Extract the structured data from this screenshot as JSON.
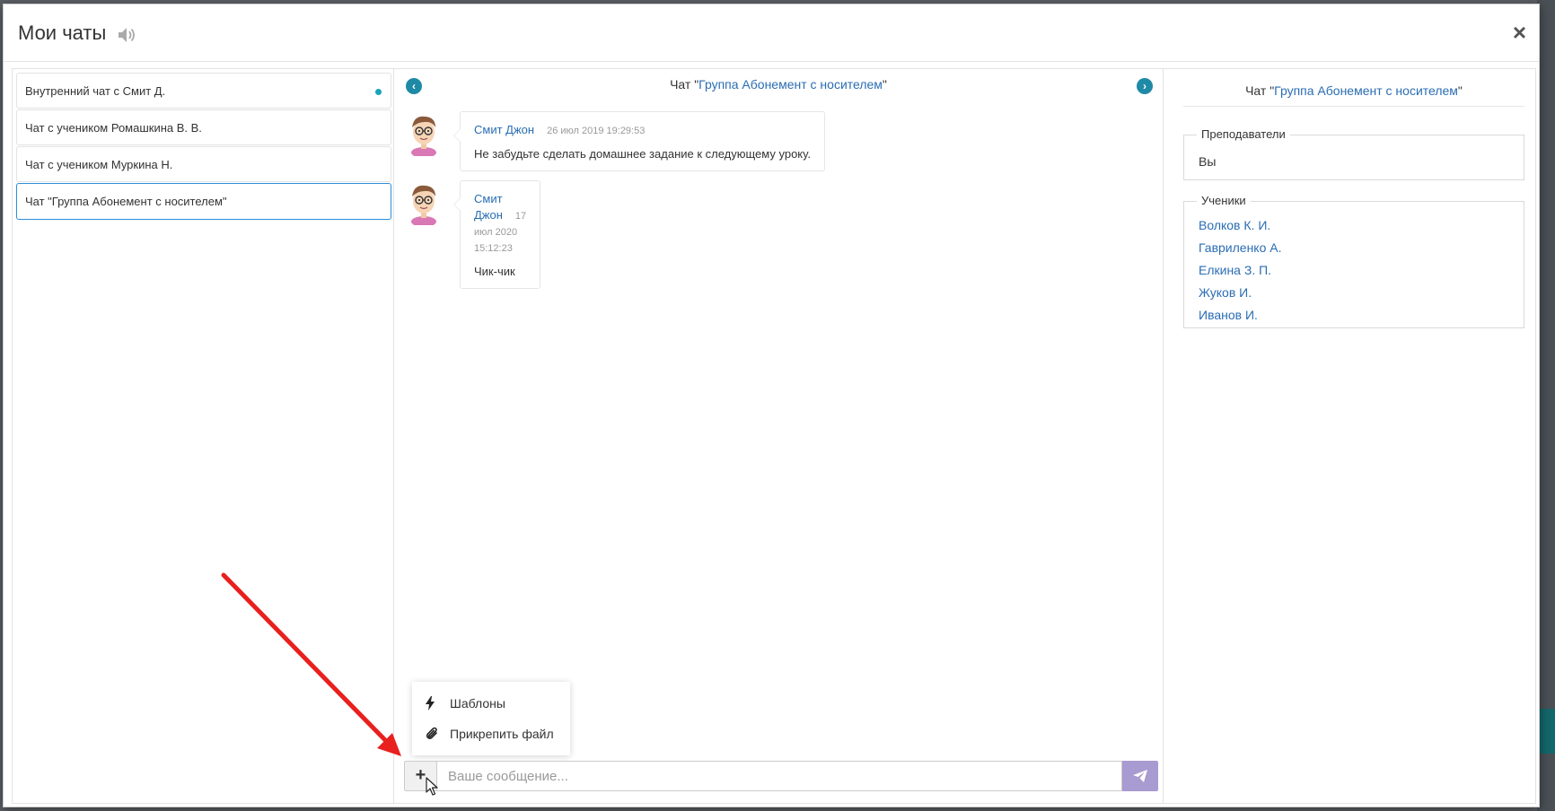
{
  "colors": {
    "link": "#2a6db3",
    "active_border": "#2d8ed8",
    "unread_dot": "#1aa3b8",
    "nav_arrow": "#1f8aa6",
    "send_button": "#a79bd1",
    "annotation_arrow": "#e8201e"
  },
  "modal": {
    "title": "Мои чаты",
    "close_label": "×"
  },
  "chat_list": [
    {
      "label": "Внутренний чат с Смит Д.",
      "unread": true
    },
    {
      "label": "Чат с учеником Ромашкина В. В.",
      "unread": false
    },
    {
      "label": "Чат с учеником Муркина Н.",
      "unread": false
    },
    {
      "label": "Чат \"Группа Абонемент с носителем\"",
      "unread": false,
      "active": true
    }
  ],
  "chat": {
    "prefix": "Чат \"",
    "name": "Группа Абонемент с носителем",
    "suffix": "\"",
    "messages": [
      {
        "author": "Смит Джон",
        "time": "26 июл 2019 19:29:53",
        "text": "Не забудьте сделать домашнее задание к следующему уроку."
      },
      {
        "author": "Смит Джон",
        "time": "17 июл 2020 15:12:23",
        "text": "Чик-чик"
      }
    ]
  },
  "menu": {
    "templates_label": "Шаблоны",
    "attach_label": "Прикрепить файл"
  },
  "composer": {
    "plus_label": "+",
    "placeholder": "Ваше сообщение...",
    "value": ""
  },
  "info": {
    "prefix": "Чат \"",
    "name": "Группа Абонемент с носителем",
    "suffix": "\"",
    "teachers_legend": "Преподаватели",
    "teachers_value": "Вы",
    "students_legend": "Ученики",
    "students": [
      "Волков К. И.",
      "Гавриленко А.",
      "Елкина З. П.",
      "Жуков И.",
      "Иванов И."
    ]
  }
}
